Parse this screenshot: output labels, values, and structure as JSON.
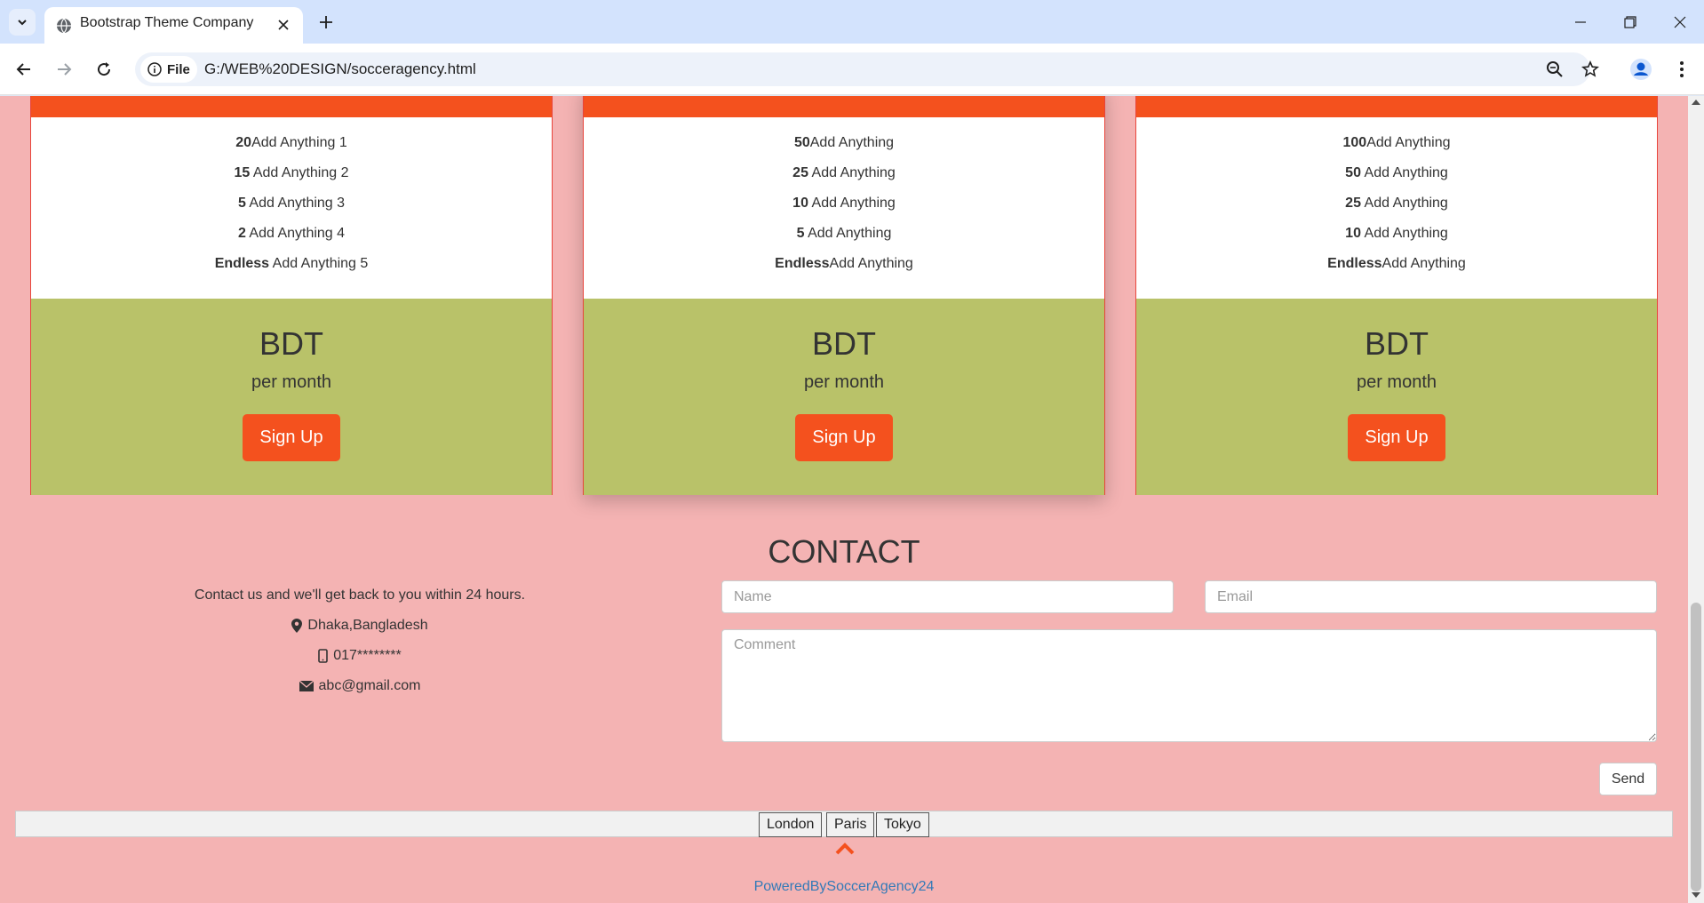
{
  "browser": {
    "tab_title": "Bootstrap Theme Company",
    "site_chip": "File",
    "url": "G:/WEB%20DESIGN/socceragency.html"
  },
  "plans": [
    {
      "rows": [
        {
          "bold": "20",
          "text": "Add Anything 1"
        },
        {
          "bold": "15",
          "text": " Add Anything 2"
        },
        {
          "bold": "5",
          "text": " Add Anything 3"
        },
        {
          "bold": "2",
          "text": " Add Anything 4"
        },
        {
          "bold": "Endless",
          "text": " Add Anything 5"
        }
      ],
      "currency": "BDT",
      "period": "per month",
      "button": "Sign Up"
    },
    {
      "rows": [
        {
          "bold": "50",
          "text": "Add Anything"
        },
        {
          "bold": "25",
          "text": " Add Anything"
        },
        {
          "bold": "10",
          "text": " Add Anything"
        },
        {
          "bold": "5",
          "text": " Add Anything"
        },
        {
          "bold": "Endless",
          "text": "Add Anything"
        }
      ],
      "currency": "BDT",
      "period": "per month",
      "button": "Sign Up"
    },
    {
      "rows": [
        {
          "bold": "100",
          "text": "Add Anything"
        },
        {
          "bold": "50",
          "text": " Add Anything"
        },
        {
          "bold": "25",
          "text": " Add Anything"
        },
        {
          "bold": "10",
          "text": " Add Anything"
        },
        {
          "bold": "Endless",
          "text": "Add Anything"
        }
      ],
      "currency": "BDT",
      "period": "per month",
      "button": "Sign Up"
    }
  ],
  "contact": {
    "title": "CONTACT",
    "intro": "Contact us and we'll get back to you within 24 hours.",
    "location": "Dhaka,Bangladesh",
    "phone": "017********",
    "email": "abc@gmail.com",
    "name_placeholder": "Name",
    "email_placeholder": "Email",
    "comment_placeholder": "Comment",
    "send_label": "Send"
  },
  "cities": [
    "London",
    "Paris",
    "Tokyo"
  ],
  "footer": {
    "powered_by": "PoweredBySoccerAgency24"
  },
  "colors": {
    "page_bg": "#f4b3b3",
    "accent": "#f4511e",
    "panel_footer": "#b9c269",
    "link": "#337ab7"
  }
}
